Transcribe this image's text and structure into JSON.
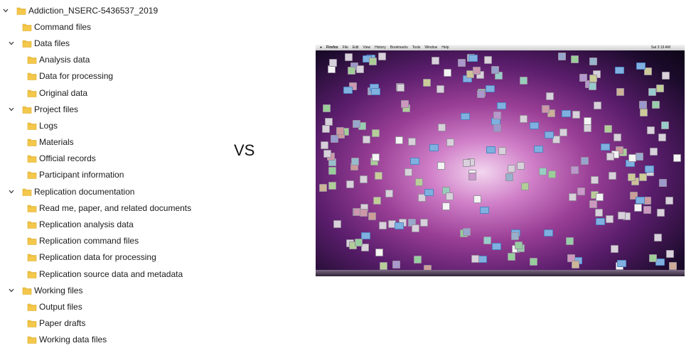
{
  "tree": {
    "root": "Addiction_NSERC-5436537_2019",
    "items": [
      {
        "label": "Command files",
        "level": 1,
        "caret": false
      },
      {
        "label": "Data files",
        "level": 1,
        "caret": true
      },
      {
        "label": "Analysis data",
        "level": 2,
        "caret": false
      },
      {
        "label": "Data for processing",
        "level": 2,
        "caret": false
      },
      {
        "label": "Original data",
        "level": 2,
        "caret": false
      },
      {
        "label": "Project files",
        "level": 1,
        "caret": true
      },
      {
        "label": "Logs",
        "level": 2,
        "caret": false
      },
      {
        "label": "Materials",
        "level": 2,
        "caret": false
      },
      {
        "label": "Official records",
        "level": 2,
        "caret": false
      },
      {
        "label": "Participant information",
        "level": 2,
        "caret": false
      },
      {
        "label": "Replication documentation",
        "level": 1,
        "caret": true
      },
      {
        "label": "Read me, paper, and related documents",
        "level": 2,
        "caret": false
      },
      {
        "label": "Replication analysis data",
        "level": 2,
        "caret": false
      },
      {
        "label": "Replication command files",
        "level": 2,
        "caret": false
      },
      {
        "label": "Replication data for processing",
        "level": 2,
        "caret": false
      },
      {
        "label": "Replication source data and metadata",
        "level": 2,
        "caret": false
      },
      {
        "label": "Working files",
        "level": 1,
        "caret": true
      },
      {
        "label": "Output files",
        "level": 2,
        "caret": false
      },
      {
        "label": "Paper drafts",
        "level": 2,
        "caret": false
      },
      {
        "label": "Working data files",
        "level": 2,
        "caret": false
      }
    ]
  },
  "vs_label": "VS",
  "desktop": {
    "menu_items": [
      "Firefox",
      "File",
      "Edit",
      "View",
      "History",
      "Bookmarks",
      "Tools",
      "Window",
      "Help"
    ],
    "clock": "Sat 3:19 AM",
    "icon_count": 220
  },
  "colors": {
    "folder": "#f4c84a",
    "folder_dark": "#d9a928"
  }
}
